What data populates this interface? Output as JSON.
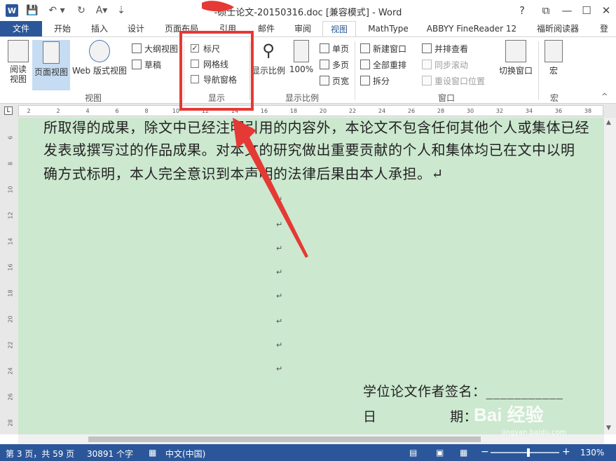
{
  "titlebar": {
    "title": "-硕士论文-20150316.doc [兼容模式] - Word",
    "help": "?",
    "ribbon_opts": "⧉",
    "minimize": "—",
    "maximize": "☐",
    "close": "✕",
    "qat_more": "⇣"
  },
  "tabs": [
    "文件",
    "开始",
    "插入",
    "设计",
    "页面布局",
    "引用",
    "邮件",
    "审阅",
    "视图",
    "MathType",
    "ABBYY FineReader 12",
    "福昕阅读器",
    "登"
  ],
  "ribbon": {
    "views": {
      "read_mode": "阅读\n视图",
      "print_layout": "页面视图",
      "web_layout": "Web 版式视图",
      "outline": "大纲视图",
      "draft": "草稿",
      "label": "视图"
    },
    "show": {
      "ruler": "标尺",
      "ruler_checked": "✓",
      "gridlines": "网格线",
      "nav_pane": "导航窗格",
      "label": "显示"
    },
    "zoom": {
      "zoom_btn": "显示比例",
      "hundred": "100%",
      "one_page": "单页",
      "multi_page": "多页",
      "page_width": "页宽",
      "label": "显示比例"
    },
    "window": {
      "new_window": "新建窗口",
      "arrange_all": "全部重排",
      "split": "拆分",
      "side_by_side": "并排查看",
      "sync_scroll": "同步滚动",
      "reset_pos": "重设窗口位置",
      "switch_windows": "切换窗口",
      "label": "窗口"
    },
    "macros": {
      "macros_btn": "宏",
      "label": "宏"
    }
  },
  "ruler_ticks": [
    "2",
    "2",
    "4",
    "6",
    "8",
    "10",
    "12",
    "14",
    "16",
    "18",
    "20",
    "22",
    "24",
    "26",
    "28",
    "30",
    "32",
    "34",
    "36",
    "38"
  ],
  "vruler_ticks": [
    "6",
    "8",
    "10",
    "12",
    "14",
    "16",
    "18",
    "20",
    "22",
    "24",
    "26",
    "28"
  ],
  "document": {
    "line1": "所取得的成果，除文中已经注明引用的内容外，本论文不包含任何其他个人或集体已经",
    "line2": "发表或撰写过的作品成果。对本文的研究做出重要贡献的个人和集体均已在文中以明",
    "line3": "确方式标明，本人完全意识到本声明的法律后果由本人承担。↵",
    "para_mark": "↵",
    "author_sig": "学位论文作者签名：___________",
    "date_line": "日                期："
  },
  "statusbar": {
    "page": "第 3 页，共 59 页",
    "words": "30891 个字",
    "language": "中文(中国)",
    "zoom": "130%",
    "zoom_minus": "−",
    "zoom_plus": "+"
  },
  "watermark": {
    "brand": "Bai 经验",
    "url": "jingyan.baidu.com"
  },
  "colors": {
    "accent": "#2b579a",
    "doc_bg": "#cce8cf",
    "annotation": "#e53935"
  }
}
